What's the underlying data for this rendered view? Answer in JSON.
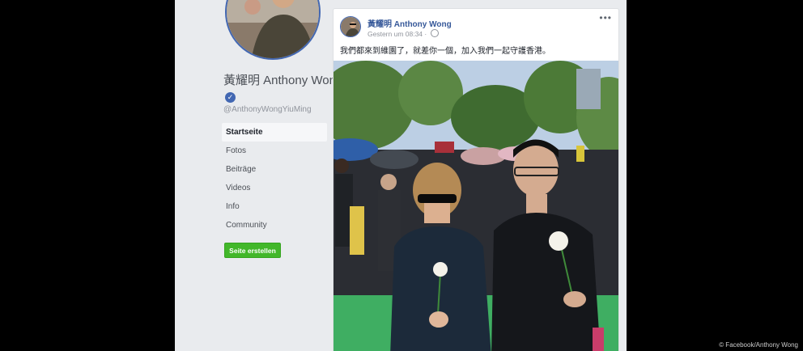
{
  "sidebar": {
    "page_name": "黃耀明 Anthony Wong",
    "handle": "@AnthonyWongYiuMing",
    "nav": [
      {
        "label": "Startseite",
        "active": true
      },
      {
        "label": "Fotos",
        "active": false
      },
      {
        "label": "Beiträge",
        "active": false
      },
      {
        "label": "Videos",
        "active": false
      },
      {
        "label": "Info",
        "active": false
      },
      {
        "label": "Community",
        "active": false
      }
    ],
    "create_button": "Seite erstellen"
  },
  "post": {
    "author": "黃耀明 Anthony Wong",
    "timestamp": "Gestern um 08:34 · ",
    "text": "我們都來到維園了，就差你一個，加入我們一起守護香港。",
    "menu_icon": "more-dots-icon",
    "privacy_icon": "globe-icon"
  },
  "credit": "© Facebook/Anthony Wong",
  "colors": {
    "background": "#000000",
    "facebook_blue": "#4267b2",
    "link_blue": "#365899",
    "green_button": "#42b72a"
  }
}
